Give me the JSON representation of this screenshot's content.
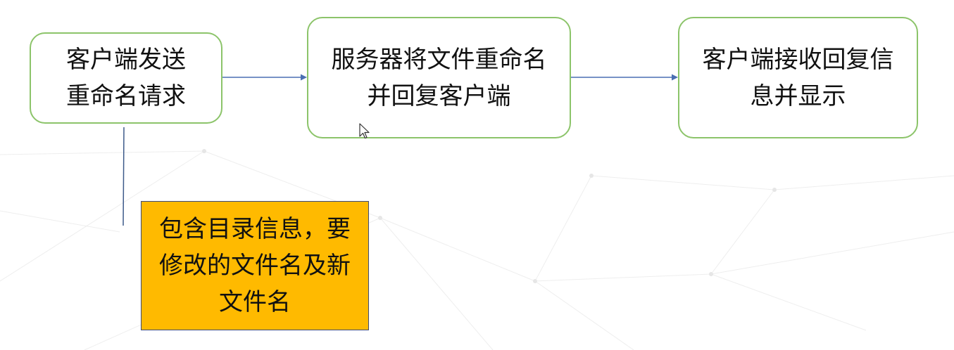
{
  "flow": {
    "steps": [
      {
        "label": "客户端发送重命名请求"
      },
      {
        "label": "服务器将文件重命名并回复客户端"
      },
      {
        "label": "客户端接收回复信息并显示"
      }
    ],
    "note": {
      "label": "包含目录信息，要修改的文件名及新文件名"
    }
  },
  "colors": {
    "node_border": "#8cc46a",
    "note_fill": "#ffba00",
    "note_border": "#3d4a7a",
    "connector": "#4a6fb3"
  },
  "icons": {
    "pointer": "mouse-cursor-icon"
  }
}
